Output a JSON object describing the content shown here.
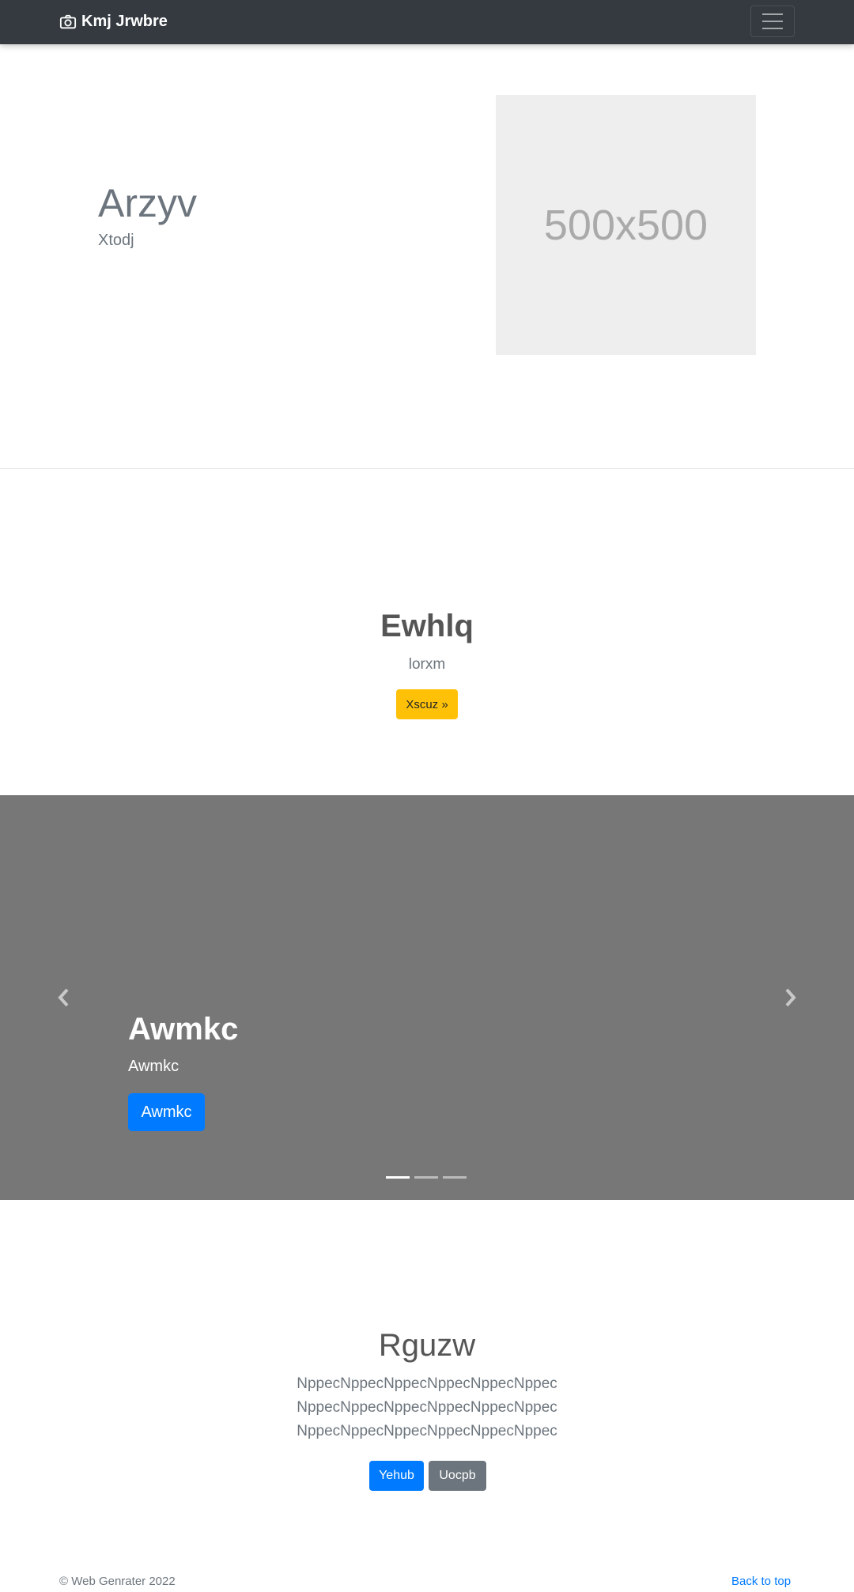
{
  "navbar": {
    "brand": "Kmj Jrwbre",
    "brand_icon": "camera-icon",
    "toggler_icon": "hamburger-menu-icon"
  },
  "hero": {
    "title": "Arzyv",
    "subtitle": "Xtodj",
    "image_placeholder": "500x500"
  },
  "section2": {
    "title": "Ewhlq",
    "subtitle": "lorxm",
    "button": "Xscuz »"
  },
  "carousel": {
    "title": "Awmkc",
    "subtitle": "Awmkc",
    "button": "Awmkc",
    "prev_icon": "chevron-left-icon",
    "next_icon": "chevron-right-icon",
    "slide_count": 3,
    "active_slide": 1
  },
  "section4": {
    "title": "Rguzw",
    "lines": [
      "NppecNppecNppecNppecNppecNppec",
      "NppecNppecNppecNppecNppecNppec",
      "NppecNppecNppecNppecNppecNppec"
    ],
    "primary_button": "Yehub",
    "secondary_button": "Uocpb"
  },
  "footer": {
    "copyright": "© Web Genrater 2022",
    "back_to_top": "Back to top"
  },
  "colors": {
    "navbar": "#343a40",
    "primary": "#007bff",
    "warning": "#ffc107",
    "secondary": "#6c757d",
    "carousel_bg": "#777777"
  }
}
